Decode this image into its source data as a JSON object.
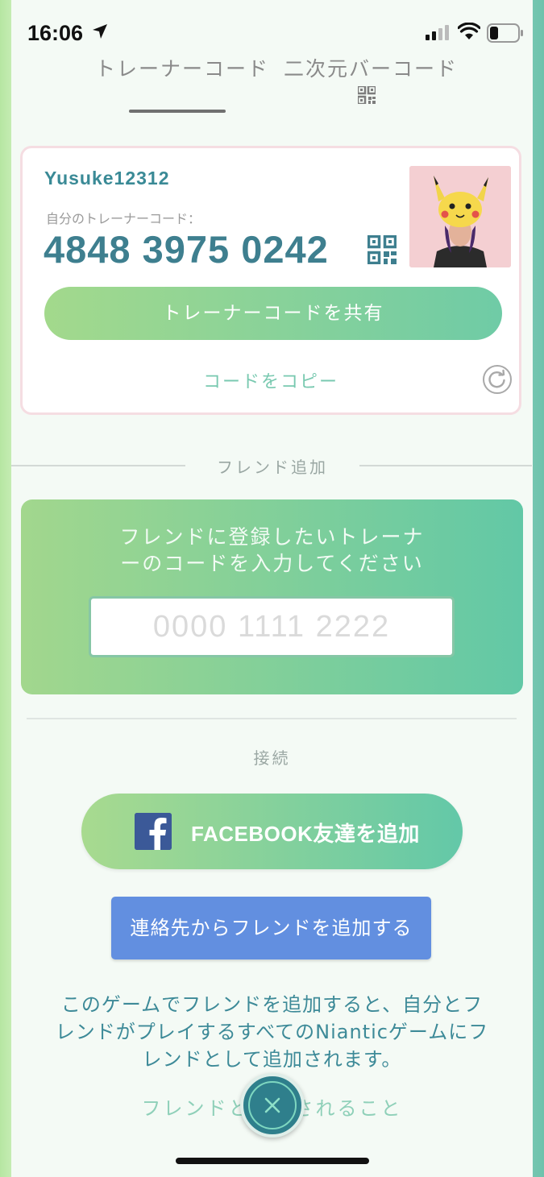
{
  "status_bar": {
    "time": "16:06"
  },
  "tabs": [
    {
      "label": "トレーナーコード"
    },
    {
      "label": "二次元バーコード"
    }
  ],
  "trainer_card": {
    "username": "Yusuke12312",
    "code_label": "自分のトレーナーコード：",
    "code": "4848 3975 0242",
    "share_button": "トレーナーコードを共有",
    "copy_link": "コードをコピー"
  },
  "friend_add": {
    "section_label": "フレンド追加",
    "instruction_line1": "フレンドに登録したいトレーナ",
    "instruction_line2": "ーのコードを入力してください",
    "input_placeholder": "0000 1111 2222",
    "input_value": ""
  },
  "connect": {
    "label": "接続",
    "facebook_button": "FACEBOOK友達を追加",
    "contacts_button": "連絡先からフレンドを追加する"
  },
  "note": {
    "line1": "このゲームでフレンドを追加すると、自分とフ",
    "line2": "レンドがプレイするすべてのNianticゲームにフ",
    "line3": "レンドとして追加されます。"
  },
  "footer_link": "フレンドと　　されること",
  "icons": {
    "location": "location-arrow-icon",
    "signal": "cellular-signal-icon",
    "wifi": "wifi-icon",
    "battery": "battery-icon",
    "qr": "qr-code-icon",
    "refresh": "refresh-icon",
    "facebook": "facebook-icon",
    "close": "close-icon"
  },
  "colors": {
    "accent_teal": "#3e7f8f",
    "gradient_start": "#a3d98c",
    "gradient_end": "#6fcba6",
    "contacts_blue": "#628fe0"
  }
}
